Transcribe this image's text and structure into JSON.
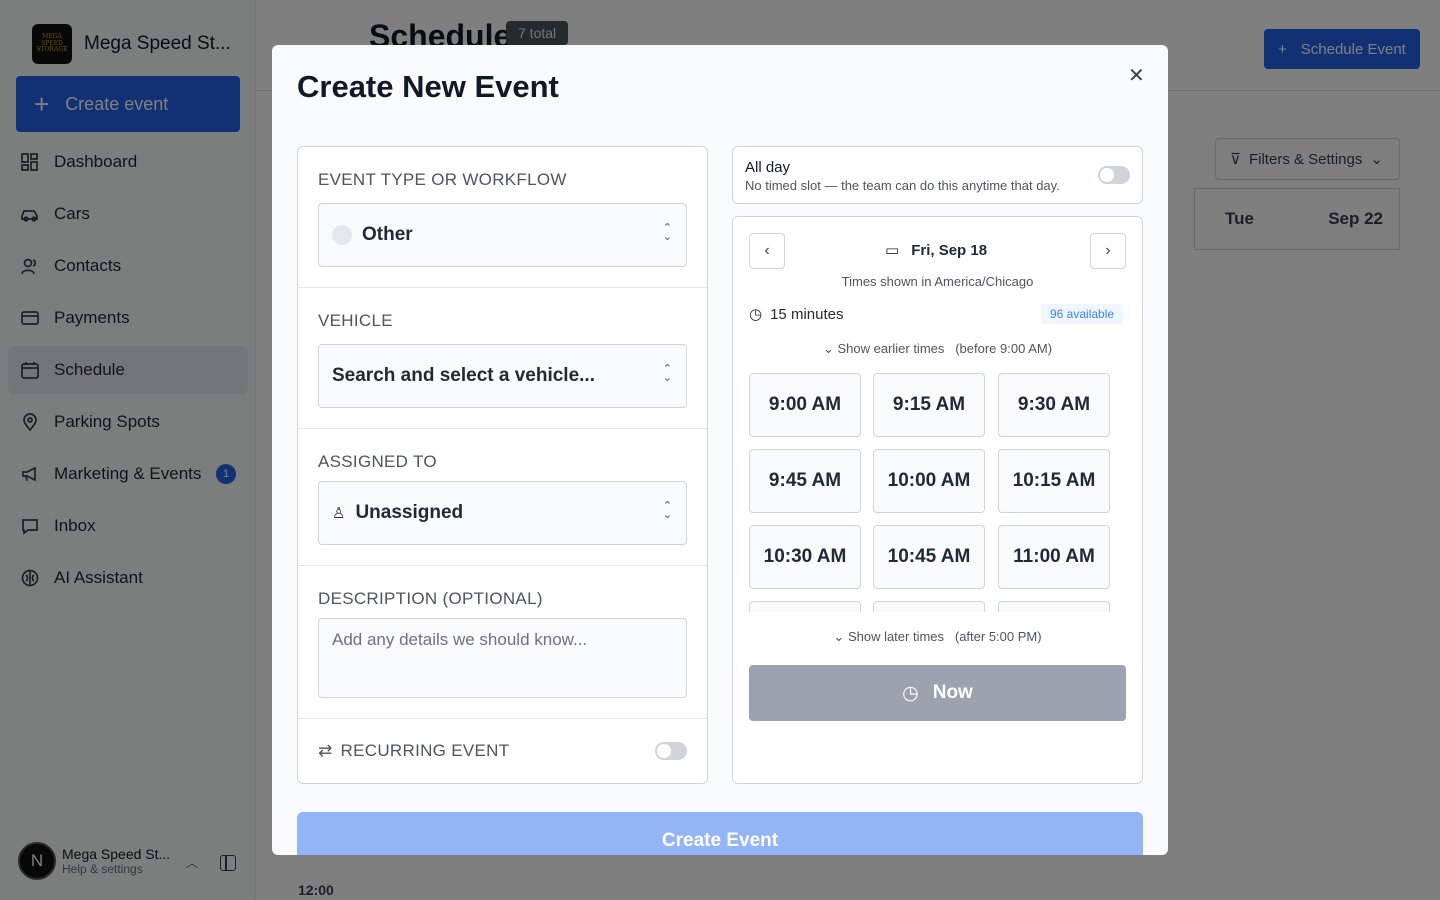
{
  "brand": {
    "name": "Mega Speed St...",
    "logo_text": "MEGA SPEED STORAGE"
  },
  "sidebar": {
    "create_label": "Create event",
    "items": [
      {
        "label": "Dashboard",
        "icon": "dashboard-icon"
      },
      {
        "label": "Cars",
        "icon": "car-icon"
      },
      {
        "label": "Contacts",
        "icon": "contacts-icon"
      },
      {
        "label": "Payments",
        "icon": "card-icon"
      },
      {
        "label": "Schedule",
        "icon": "calendar-icon",
        "active": true
      },
      {
        "label": "Parking Spots",
        "icon": "pin-icon"
      },
      {
        "label": "Marketing & Events",
        "icon": "megaphone-icon",
        "badge": "1"
      },
      {
        "label": "Inbox",
        "icon": "inbox-icon"
      },
      {
        "label": "AI Assistant",
        "icon": "brain-icon"
      }
    ],
    "user": {
      "initial": "N",
      "name": "Mega Speed St...",
      "sub": "Help & settings"
    }
  },
  "main": {
    "title": "Schedule",
    "total": "7 total",
    "schedule_button": "Schedule Event",
    "filters": "Filters & Settings",
    "calendar": {
      "day": "Tue",
      "date": "Sep 22",
      "time_label": "12:00"
    }
  },
  "modal": {
    "title": "Create New Event",
    "event_type": {
      "label": "EVENT TYPE OR WORKFLOW",
      "value": "Other"
    },
    "vehicle": {
      "label": "VEHICLE",
      "value": "Search and select a vehicle..."
    },
    "assigned": {
      "label": "ASSIGNED TO",
      "value": "Unassigned"
    },
    "description": {
      "label": "DESCRIPTION (OPTIONAL)",
      "placeholder": "Add any details we should know..."
    },
    "recurring": {
      "label": "RECURRING EVENT",
      "enabled": false
    },
    "all_day": {
      "title": "All day",
      "subtitle": "No timed slot — the team can do this anytime that day.",
      "enabled": false
    },
    "picker": {
      "date": "Fri, Sep 18",
      "timezone": "Times shown in America/Chicago",
      "duration": "15 minutes",
      "available": "96 available",
      "earlier": "Show earlier times   (before 9:00 AM)",
      "later": "Show later times   (after 5:00 PM)",
      "slots": [
        "9:00 AM",
        "9:15 AM",
        "9:30 AM",
        "9:45 AM",
        "10:00 AM",
        "10:15 AM",
        "10:30 AM",
        "10:45 AM",
        "11:00 AM"
      ],
      "now_label": "Now"
    },
    "submit_label": "Create Event"
  }
}
